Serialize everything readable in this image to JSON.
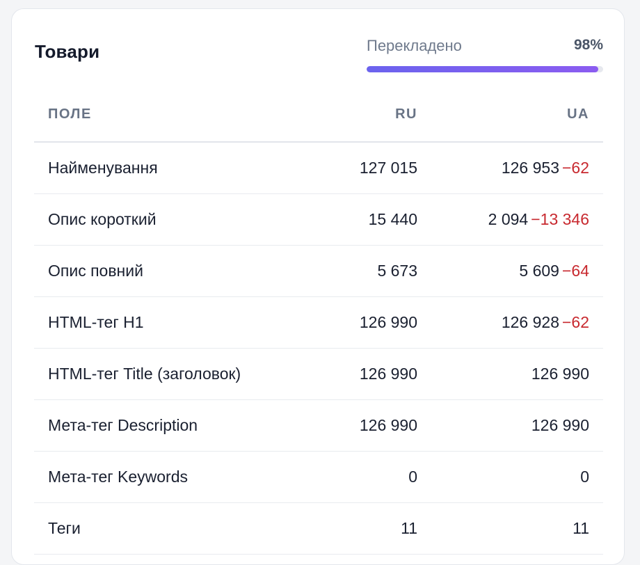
{
  "card": {
    "title": "Товари",
    "progress": {
      "label": "Перекладено",
      "value_text": "98%",
      "value": 98,
      "colors": {
        "fill_start": "#6b63ee",
        "fill_end": "#8b5cf0",
        "track": "#e6e8ee"
      }
    }
  },
  "table": {
    "headers": {
      "field": "ПОЛЕ",
      "ru": "RU",
      "ua": "UA"
    },
    "rows": [
      {
        "field": "Найменування",
        "ru": "127 015",
        "ua": "126 953",
        "diff": "−62"
      },
      {
        "field": "Опис короткий",
        "ru": "15 440",
        "ua": "2 094",
        "diff": "−13 346"
      },
      {
        "field": "Опис повний",
        "ru": "5 673",
        "ua": "5 609",
        "diff": "−64"
      },
      {
        "field": "HTML-тег H1",
        "ru": "126 990",
        "ua": "126 928",
        "diff": "−62"
      },
      {
        "field": "HTML-тег Title (заголовок)",
        "ru": "126 990",
        "ua": "126 990",
        "diff": ""
      },
      {
        "field": "Мета-тег Description",
        "ru": "126 990",
        "ua": "126 990",
        "diff": ""
      },
      {
        "field": "Мета-тег Keywords",
        "ru": "0",
        "ua": "0",
        "diff": ""
      },
      {
        "field": "Теги",
        "ru": "11",
        "ua": "11",
        "diff": ""
      }
    ],
    "colors": {
      "negative_diff": "#c8292f"
    }
  }
}
